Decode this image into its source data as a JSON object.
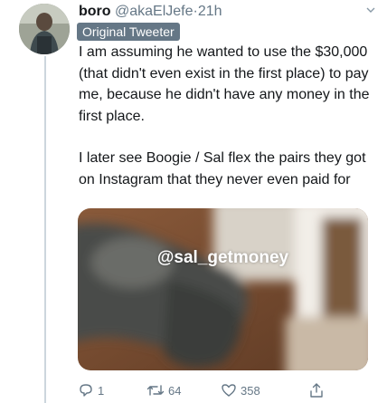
{
  "tweet": {
    "display_name": "boro",
    "handle": "@akaElJefe",
    "separator": "·",
    "time": "21h",
    "badge": "Original Tweeter",
    "paragraphs": [
      "I am assuming he wanted to use the $30,000 (that didn't even exist in the first place) to pay me, because he didn't have any money in the first place.",
      "I later see Boogie / Sal flex the pairs they got on Instagram that they never even paid for"
    ],
    "media": {
      "overlay_text": "@sal_getmoney"
    },
    "actions": {
      "reply_count": "1",
      "retweet_count": "64",
      "like_count": "358"
    }
  },
  "colors": {
    "text": "#14171a",
    "secondary": "#657786",
    "thread_line": "#ccd6dd"
  },
  "icons": [
    "chevron-down-icon",
    "reply-icon",
    "retweet-icon",
    "like-icon",
    "share-icon"
  ]
}
